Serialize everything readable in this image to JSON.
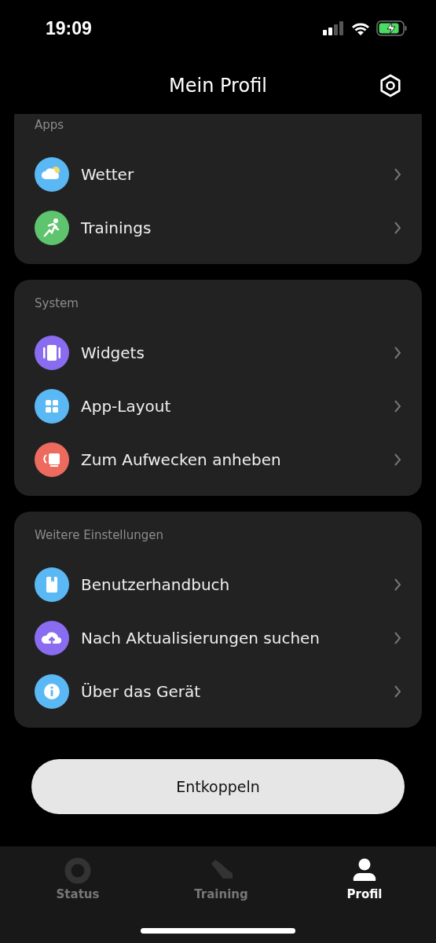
{
  "status_bar": {
    "time": "19:09"
  },
  "header": {
    "title": "Mein Profil"
  },
  "sections": [
    {
      "title": "Apps",
      "items": [
        {
          "label": "Wetter",
          "kind": "weather",
          "color": "#5ab8f5"
        },
        {
          "label": "Trainings",
          "kind": "runner",
          "color": "#5ec46e"
        }
      ]
    },
    {
      "title": "System",
      "items": [
        {
          "label": "Widgets",
          "kind": "widgets",
          "color": "#8a6cf0"
        },
        {
          "label": "App-Layout",
          "kind": "grid",
          "color": "#5ab8f5"
        },
        {
          "label": "Zum Aufwecken anheben",
          "kind": "raise",
          "color": "#ec6b5e"
        }
      ]
    },
    {
      "title": "Weitere Einstellungen",
      "items": [
        {
          "label": "Benutzerhandbuch",
          "kind": "book",
          "color": "#5ab8f5"
        },
        {
          "label": "Nach Aktualisierungen suchen",
          "kind": "upload",
          "color": "#8a6cf0"
        },
        {
          "label": "Über das Gerät",
          "kind": "info",
          "color": "#5ab8f5"
        }
      ]
    }
  ],
  "unpair_button": "Entkoppeln",
  "tabs": [
    {
      "label": "Status",
      "kind": "ring",
      "selected": false
    },
    {
      "label": "Training",
      "kind": "shoe",
      "selected": false
    },
    {
      "label": "Profil",
      "kind": "person",
      "selected": true
    }
  ]
}
